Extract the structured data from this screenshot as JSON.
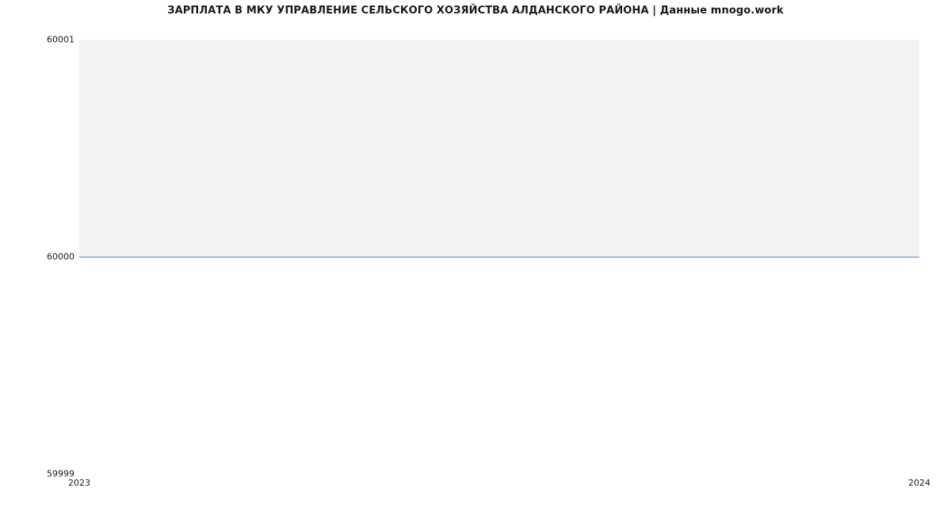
{
  "chart_data": {
    "type": "line",
    "title": "ЗАРПЛАТА В МКУ  УПРАВЛЕНИЕ СЕЛЬСКОГО ХОЗЯЙСТВА АЛДАНСКОГО РАЙОНА | Данные mnogo.work",
    "x": [
      2023,
      2024
    ],
    "values": [
      60000,
      60000
    ],
    "xlabel": "",
    "ylabel": "",
    "xlim": [
      2023,
      2024
    ],
    "ylim": [
      59999,
      60001
    ],
    "x_ticks": [
      "2023",
      "2024"
    ],
    "y_ticks": [
      "59999",
      "60000",
      "60001"
    ],
    "grid": false,
    "bands": [
      [
        60000,
        60001
      ]
    ]
  }
}
